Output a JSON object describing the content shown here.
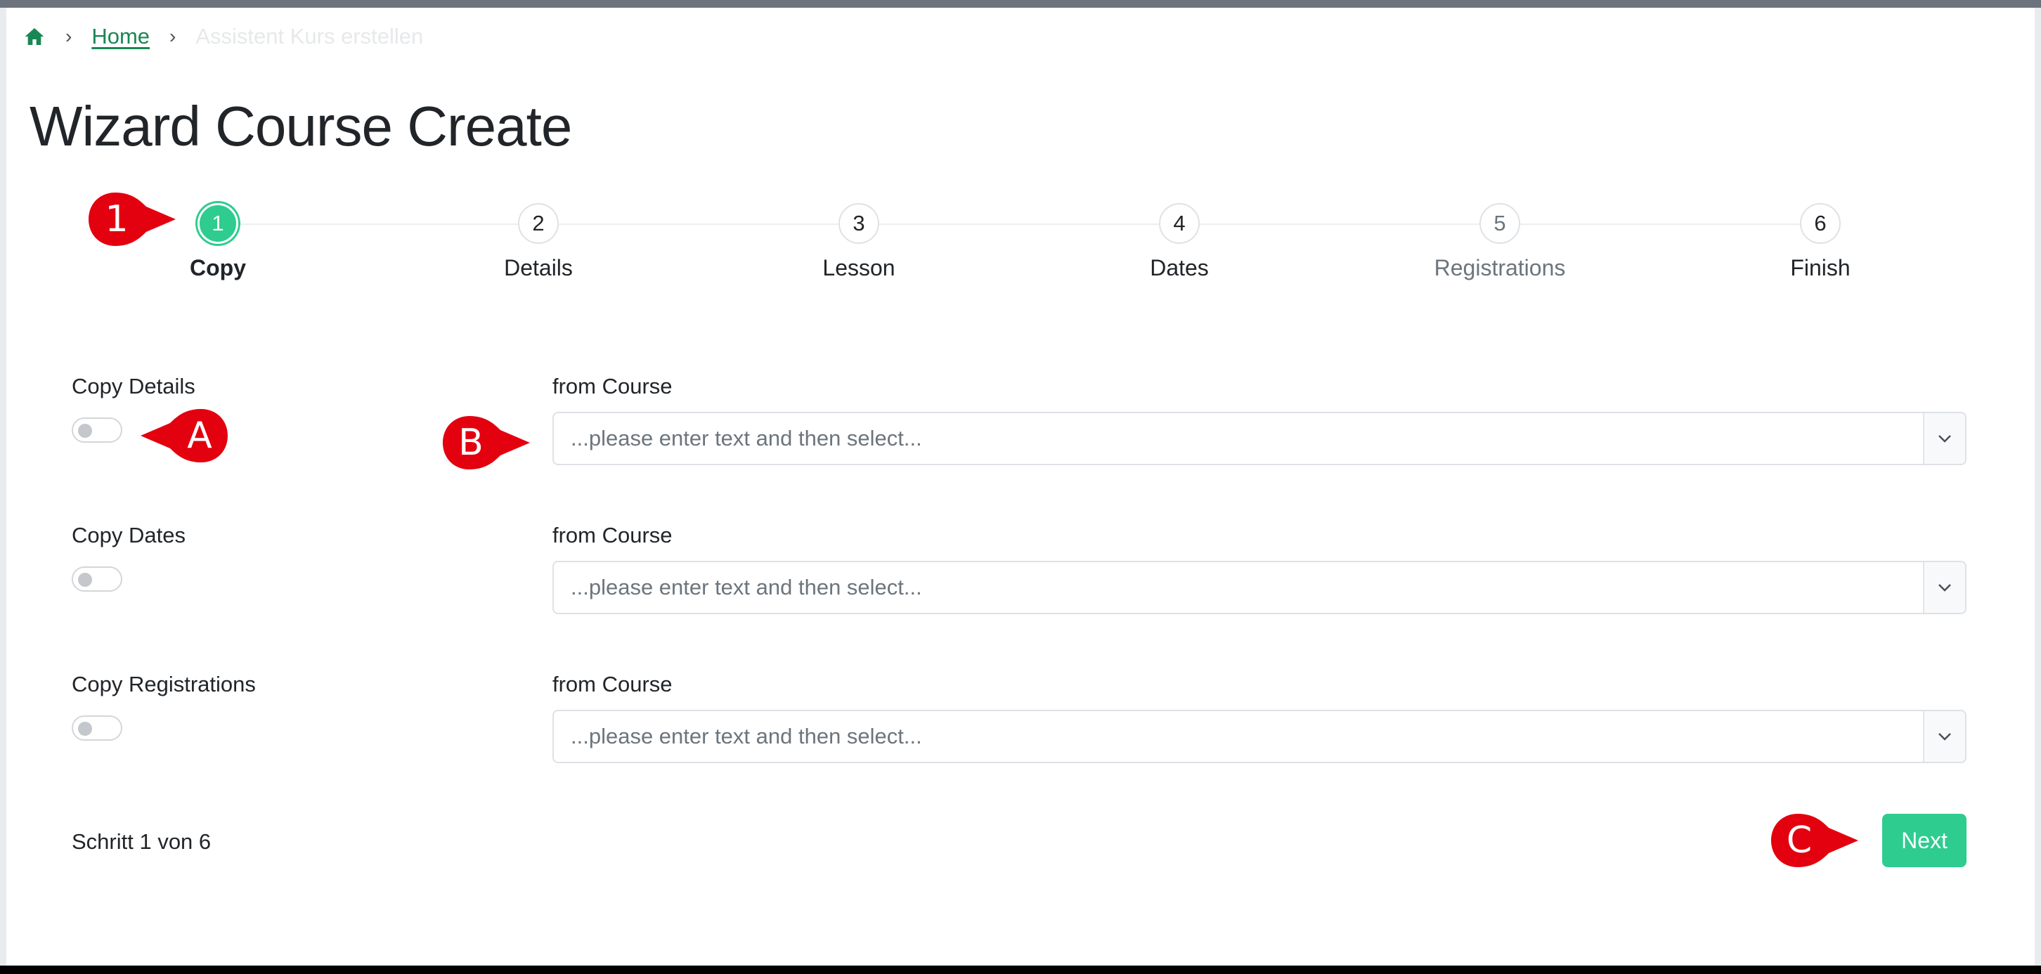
{
  "breadcrumb": {
    "home_icon": "home-icon",
    "separator": "›",
    "home_label": "Home",
    "current_label": "Assistent Kurs erstellen"
  },
  "page_title": "Wizard Course Create",
  "stepper": {
    "steps": [
      {
        "number": "1",
        "label": "Copy",
        "state": "active"
      },
      {
        "number": "2",
        "label": "Details",
        "state": "default"
      },
      {
        "number": "3",
        "label": "Lesson",
        "state": "default"
      },
      {
        "number": "4",
        "label": "Dates",
        "state": "default"
      },
      {
        "number": "5",
        "label": "Registrations",
        "state": "muted"
      },
      {
        "number": "6",
        "label": "Finish",
        "state": "default"
      }
    ]
  },
  "form": {
    "rows": [
      {
        "toggle_label": "Copy Details",
        "toggle_on": false,
        "from_label": "from Course",
        "select_placeholder": "...please enter text and then select..."
      },
      {
        "toggle_label": "Copy Dates",
        "toggle_on": false,
        "from_label": "from Course",
        "select_placeholder": "...please enter text and then select..."
      },
      {
        "toggle_label": "Copy Registrations",
        "toggle_on": false,
        "from_label": "from Course",
        "select_placeholder": "...please enter text and then select..."
      }
    ]
  },
  "footer": {
    "step_status": "Schritt 1 von 6",
    "next_label": "Next"
  },
  "callouts": {
    "step": "1",
    "toggle": "A",
    "select": "B",
    "next": "C"
  },
  "colors": {
    "accent": "#2ecc8f",
    "link": "#198754",
    "callout": "#e3000f"
  }
}
